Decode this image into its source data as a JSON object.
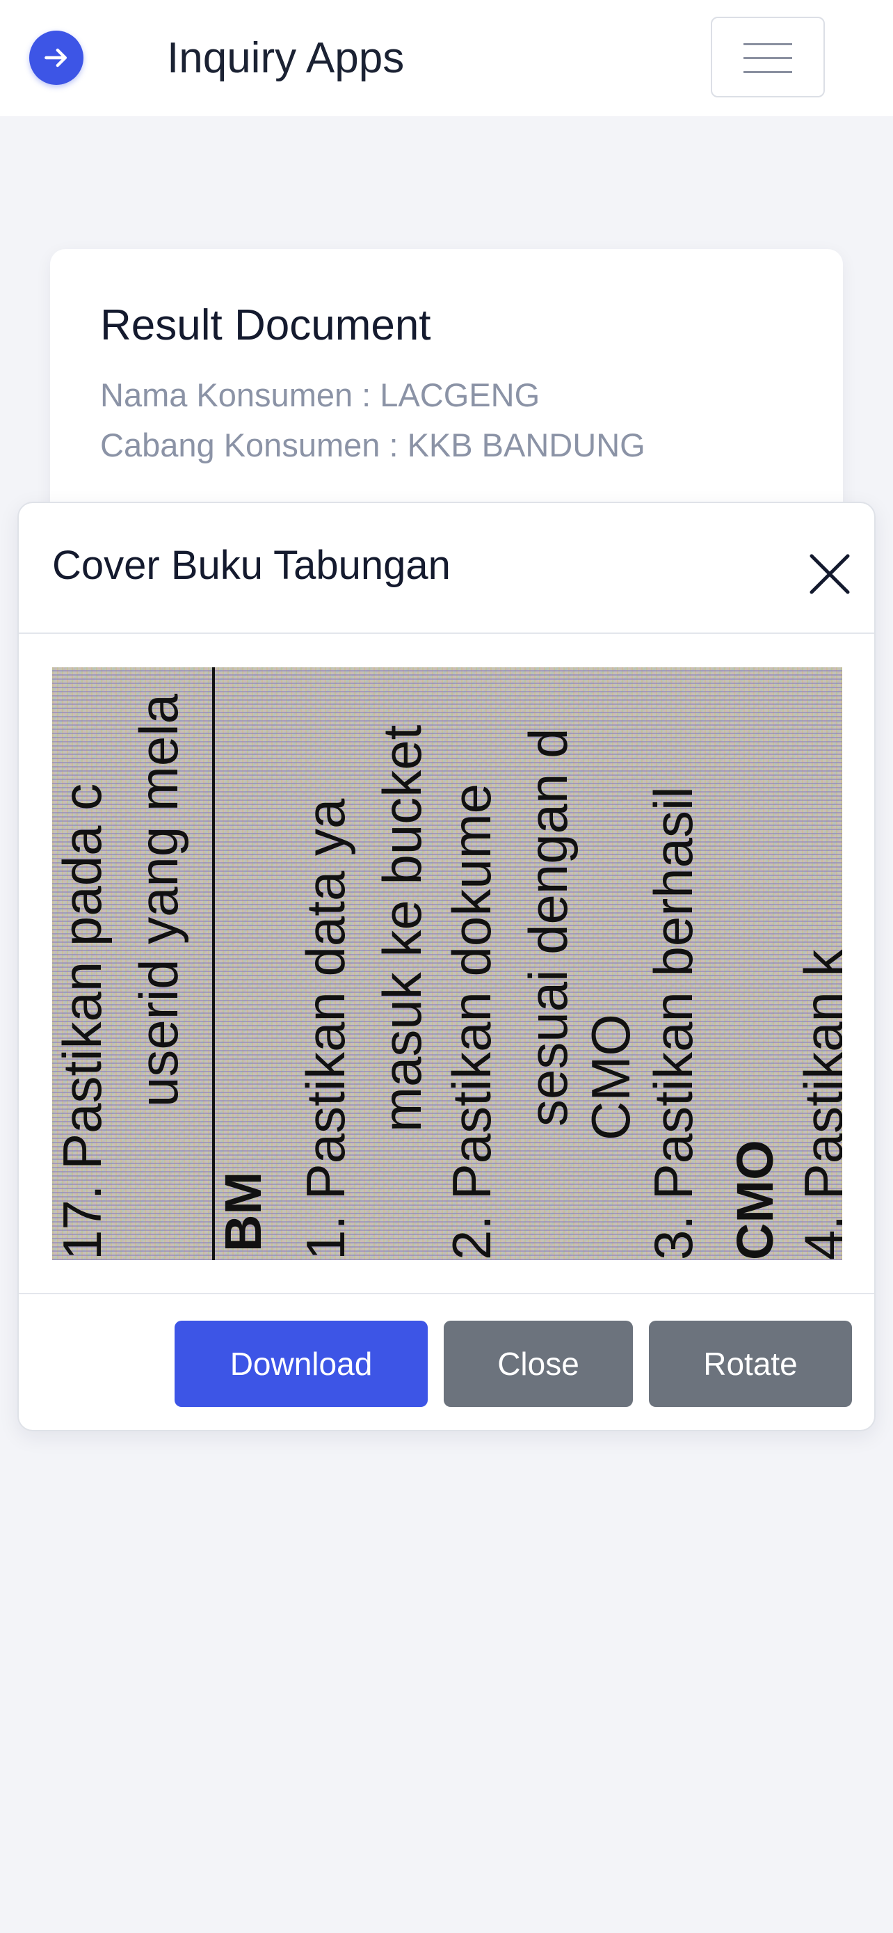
{
  "navbar": {
    "icon": "arrow-right-circle-icon",
    "title": "Inquiry Apps",
    "menu_icon": "hamburger-icon",
    "accent_color": "#3d55e6"
  },
  "result_card": {
    "title": "Result Document",
    "nama_konsumen": "Nama Konsumen : LACGENG",
    "cabang_konsumen": "Cabang Konsumen : KKB BANDUNG"
  },
  "modal": {
    "title": "Cover Buku Tabungan",
    "close_icon": "close-icon",
    "document_image": {
      "lines": [
        "17. Pastikan pada c",
        "userid yang mela",
        "BM",
        "1.  Pastikan data ya",
        "masuk ke bucket",
        "2.  Pastikan dokume",
        "sesuai dengan d",
        "CMO",
        "3.  Pastikan berhasil",
        "CMO",
        "4.  Pastikan k"
      ]
    },
    "buttons": {
      "download": "Download",
      "close": "Close",
      "rotate": "Rotate"
    }
  }
}
